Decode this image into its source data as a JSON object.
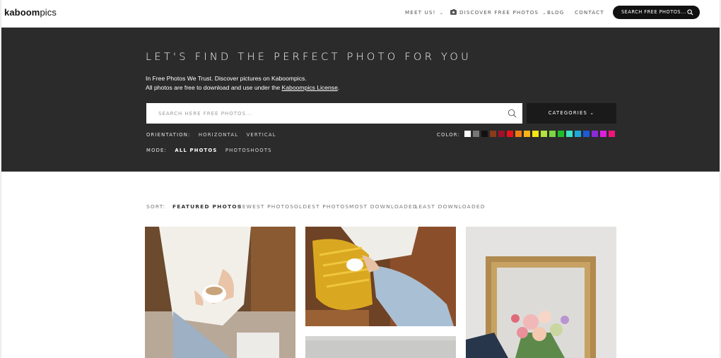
{
  "header": {
    "logo_bold": "kaboom",
    "logo_light": "pics",
    "nav": {
      "meet_us": "MEET US!",
      "discover": "DISCOVER FREE PHOTOS",
      "blog": "BLOG",
      "contact": "CONTACT"
    },
    "search_pill_label": "SEARCH FREE PHOTOS...",
    "chevron": "⌄"
  },
  "hero": {
    "title": "LET'S FIND THE PERFECT PHOTO FOR YOU",
    "tagline": "In Free Photos We Trust. Discover pictures on Kaboompics.",
    "license_prefix": "All photos are free to download and use under the ",
    "license_link": "Kaboompics License",
    "license_suffix": ".",
    "search_placeholder": "SEARCH HERE FREE PHOTOS...",
    "categories_label": "CATEGORIES",
    "orientation_label": "ORIENTATION:",
    "orientation_options": [
      "HORIZONTAL",
      "VERTICAL"
    ],
    "mode_label": "MODE:",
    "mode_options": [
      "ALL PHOTOS",
      "PHOTOSHOOTS"
    ],
    "mode_selected": "ALL PHOTOS",
    "color_label": "COLOR:",
    "colors": [
      "#ffffff",
      "#777777",
      "#111111",
      "#8b3a1a",
      "#a0102a",
      "#e8121a",
      "#f07d14",
      "#f6b418",
      "#f4e614",
      "#b4e43c",
      "#7ed640",
      "#1ebe2a",
      "#3ee0c0",
      "#1ea8d8",
      "#1e5ad8",
      "#8c2ad8",
      "#e01ee0",
      "#f0147c"
    ]
  },
  "sort": {
    "label": "SORT:",
    "options": [
      "FEATURED PHOTOS",
      "NEWEST PHOTOS",
      "OLDEST PHOTOS",
      "MOST DOWNLOADED",
      "LEAST DOWNLOADED"
    ],
    "selected": "FEATURED PHOTOS"
  },
  "colors": {
    "hero_bg": "#2b2b2b",
    "accent_dark": "#111111",
    "text_muted": "#777777"
  }
}
